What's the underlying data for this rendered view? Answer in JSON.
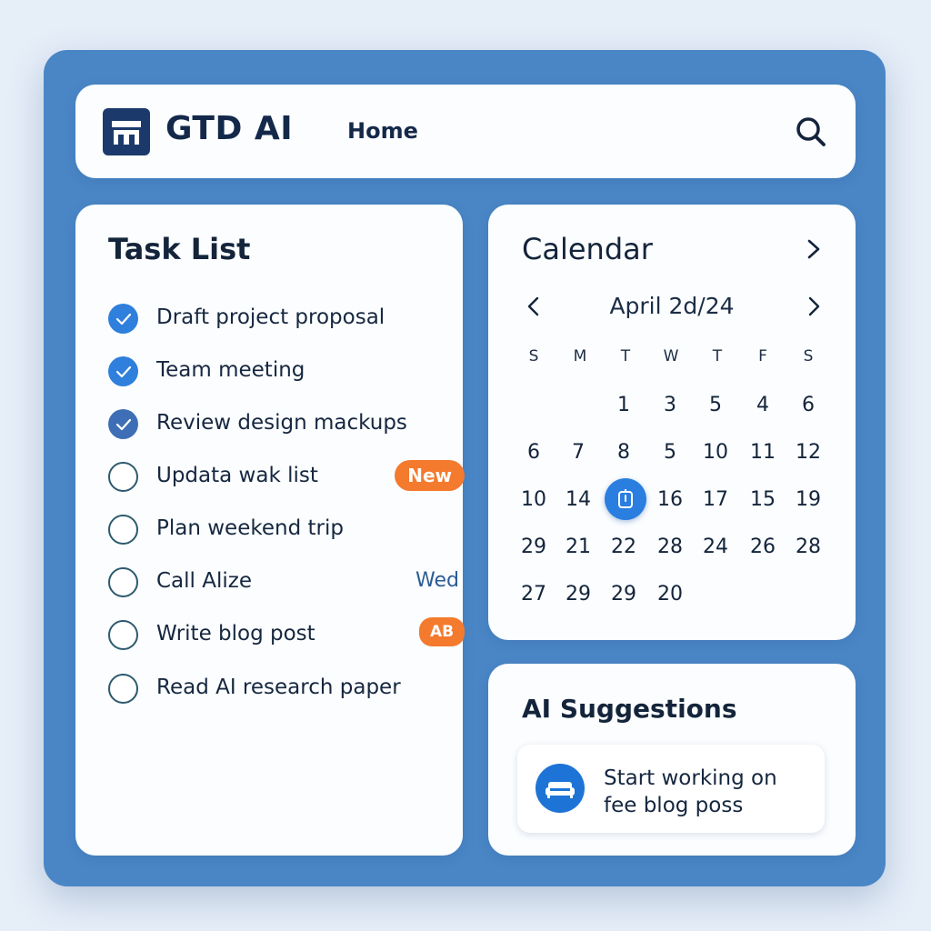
{
  "header": {
    "app_title": "GTD AI",
    "nav_home": "Home",
    "logo_icon": "store-icon",
    "search_icon": "search-icon"
  },
  "tasks": {
    "title": "Task List",
    "items": [
      {
        "label": "Draft project proposal",
        "done": true
      },
      {
        "label": "Team meeting",
        "done": true
      },
      {
        "label": "Review design mackups",
        "done": true
      },
      {
        "label": "Updata wak list",
        "done": false,
        "badge": "New"
      },
      {
        "label": "Plan weekend trip",
        "done": false
      },
      {
        "label": "Call Alize",
        "done": false,
        "badge": "Wed"
      },
      {
        "label": "Write blog post",
        "done": false,
        "badge": "AB"
      },
      {
        "label": "Read AI research paper",
        "done": false
      }
    ]
  },
  "calendar": {
    "title": "Calendar",
    "month_label": "April 2d/24",
    "weekdays": [
      "S",
      "M",
      "T",
      "W",
      "T",
      "F",
      "S"
    ],
    "weeks": [
      [
        "",
        "",
        "1",
        "3",
        "5",
        "4",
        "6"
      ],
      [
        "6",
        "7",
        "8",
        "5",
        "10",
        "11",
        "12"
      ],
      [
        "10",
        "14",
        "",
        "16",
        "17",
        "15",
        "19"
      ],
      [
        "29",
        "21",
        "22",
        "28",
        "24",
        "26",
        "28"
      ],
      [
        "27",
        "29",
        "29",
        "20",
        "",
        "",
        ""
      ]
    ],
    "today_icon": "timer-icon"
  },
  "ai": {
    "title": "AI Suggestions",
    "suggestion_line1": "Start working on",
    "suggestion_line2": "fee blog poss",
    "suggestion_icon": "sofa-icon"
  },
  "colors": {
    "frame": "#4a86c6",
    "accent": "#2f7fdc",
    "badge": "#f47a2e",
    "logo": "#1b3a6b"
  }
}
